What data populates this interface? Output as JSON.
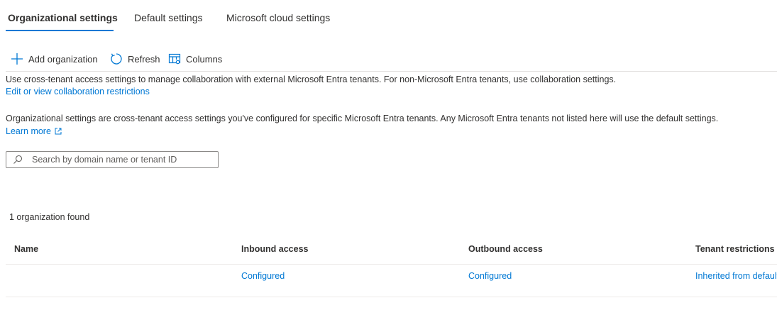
{
  "tabs": [
    {
      "label": "Organizational settings",
      "active": true
    },
    {
      "label": "Default settings",
      "active": false
    },
    {
      "label": "Microsoft cloud settings",
      "active": false
    }
  ],
  "toolbar": {
    "add_label": "Add organization",
    "refresh_label": "Refresh",
    "columns_label": "Columns"
  },
  "intro": {
    "text": "Use cross-tenant access settings to manage collaboration with external Microsoft Entra tenants. For non-Microsoft Entra tenants, use collaboration settings.",
    "link": "Edit or view collaboration restrictions"
  },
  "org_info": {
    "text": "Organizational settings are cross-tenant access settings you've configured for specific Microsoft Entra tenants. Any Microsoft Entra tenants not listed here will use the default settings.",
    "link": "Learn more"
  },
  "search": {
    "placeholder": "Search by domain name or tenant ID",
    "value": ""
  },
  "results": {
    "count_label": "1 organization found"
  },
  "table": {
    "columns": [
      "Name",
      "Inbound access",
      "Outbound access",
      "Tenant restrictions"
    ],
    "rows": [
      {
        "name": "",
        "inbound": "Configured",
        "outbound": "Configured",
        "tenant_restrictions": "Inherited from default"
      }
    ]
  },
  "colors": {
    "accent": "#0078d4",
    "text": "#323130",
    "border": "#8a8886",
    "divider": "#e1dfdd"
  },
  "icons": {
    "add": "plus-icon",
    "refresh": "refresh-icon",
    "columns": "columns-icon",
    "search": "search-icon",
    "external": "external-link-icon"
  }
}
